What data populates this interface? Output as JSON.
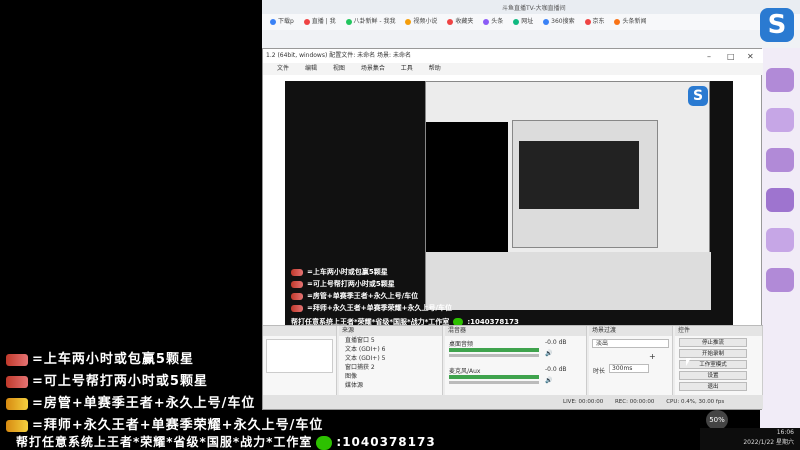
{
  "browser": {
    "title": "斗鱼直播TV-大咖直播间",
    "bookmarks": [
      "下载p",
      "直播 | 我",
      "八卦新鲜 - 我我",
      "视频小说",
      "收藏夹",
      "头条",
      "网址",
      "360搜索",
      "京东",
      "头条新闻"
    ],
    "bookmark_colors": [
      "#3b82f6",
      "#ef4444",
      "#22c55e",
      "#f59e0b",
      "#ef4444",
      "#8b5cf6",
      "#10b981",
      "#3b82f6",
      "#ef4444",
      "#f97316"
    ]
  },
  "obs": {
    "title": "1.2 (64bit, windows)  配置文件: 未命名  场景: 未命名",
    "menu": [
      "文件",
      "编辑",
      "视图",
      "场景集合",
      "工具",
      "帮助"
    ],
    "docks": {
      "scenes_title": "",
      "sources_title": "来源",
      "sources": [
        "直播窗口 5",
        "文本 (GDI+) 6",
        "文本 (GDI+) 5",
        "窗口捕获 2",
        "图像",
        "媒体源"
      ],
      "mixer_title": "混音器",
      "mixer": [
        {
          "label": "桌面音频",
          "value": "-0.0 dB"
        },
        {
          "label": "麦克风/Aux",
          "value": "-0.0 dB"
        }
      ],
      "transitions_title": "场景过渡",
      "transition": "淡出",
      "duration_label": "时长",
      "duration": "300ms",
      "controls_title": "控件",
      "controls": [
        "停止推流",
        "开始录制",
        "工作室模式",
        "设置",
        "退出"
      ]
    },
    "status": {
      "live": "LIVE: 00:00:00",
      "rec": "REC: 00:00:00",
      "cpu": "CPU: 0.4%, 30.00 fps"
    }
  },
  "overlay": {
    "lines": [
      "=上车两小时或包赢5颗星",
      "=可上号帮打两小时或5颗星",
      "=房管+单赛季王者+永久上号/车位",
      "=拜师+永久王者+单赛季荣耀+永久上号/车位"
    ],
    "footer_prefix": "帮打任意系统上王者*荣耀*省级*国服*战力*工作室",
    "footer_id": ":1040378173"
  },
  "taskbar": {
    "time": "16:06",
    "date": "2022/1/22 星期六"
  },
  "badge": "50%",
  "logo_letter": "S"
}
